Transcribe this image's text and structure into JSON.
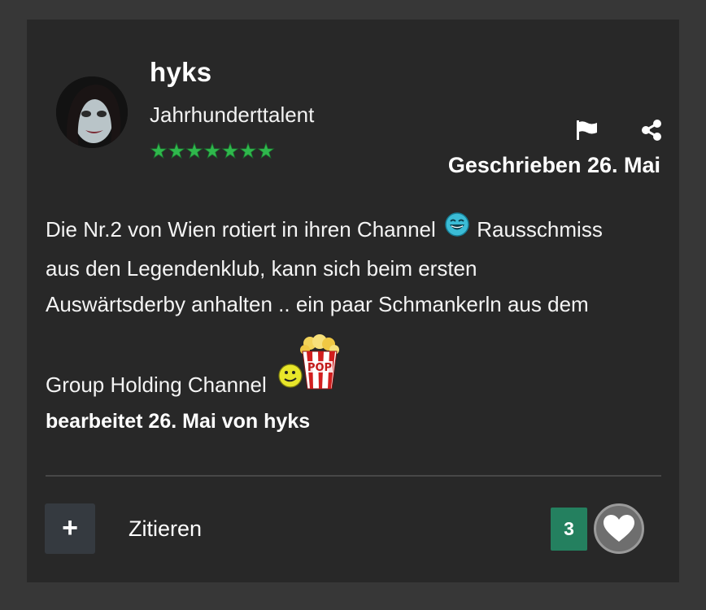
{
  "post": {
    "author": {
      "name": "hyks",
      "rank": "Jahrhunderttalent",
      "stars": 7
    },
    "date_label": "Geschrieben 26. Mai",
    "body": {
      "line1_before": "Die Nr.2 von Wien rotiert in ihren Channel ",
      "line1_after": " Rausschmiss",
      "line2": "aus den Legendenklub, kann sich beim ersten",
      "line3": "Auswärtsderby anhalten .. ein paar Schmankerln aus dem",
      "line4": "Group Holding Channel "
    },
    "edited_label": "bearbeitet 26. Mai von hyks",
    "actions": {
      "plus_symbol": "+",
      "quote_label": "Zitieren",
      "like_count": "3"
    }
  },
  "icons": {
    "flag": "flag-icon",
    "share": "share-icon",
    "heart": "heart-icon",
    "laughing": "laughing-smiley-icon",
    "popcorn": "popcorn-emoticon"
  },
  "colors": {
    "page_background": "#373737",
    "card_background": "#282828",
    "stars": "#2fb84c",
    "like_count_badge": "#24805f",
    "plus_button": "#353a40"
  }
}
